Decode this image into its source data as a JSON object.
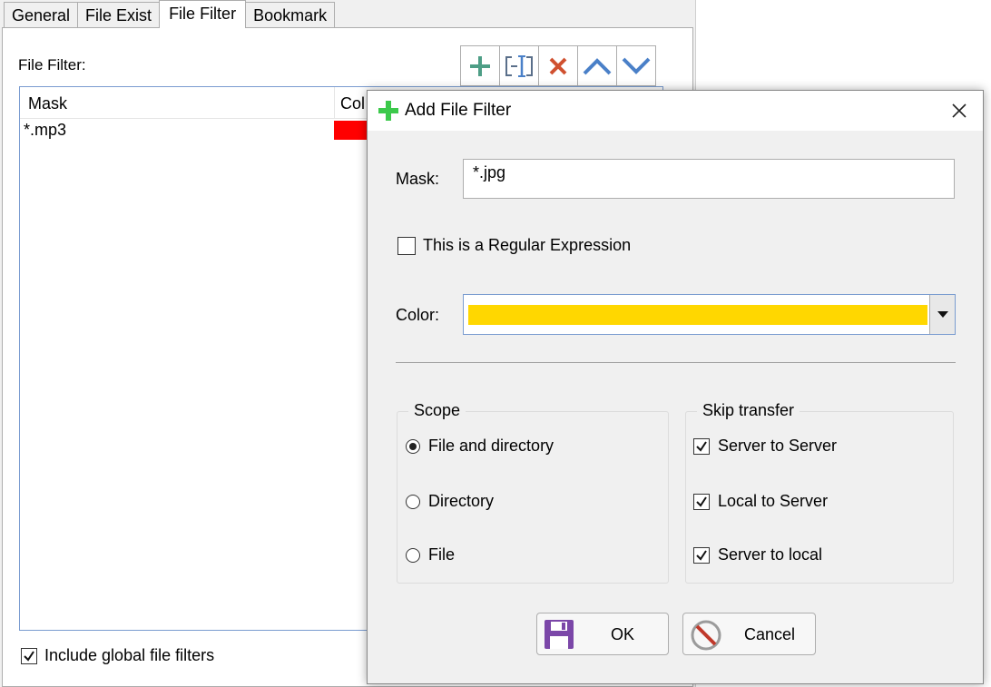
{
  "tabs": [
    {
      "label": "General",
      "active": false
    },
    {
      "label": "File Exist",
      "active": false
    },
    {
      "label": "File Filter",
      "active": true
    },
    {
      "label": "Bookmark",
      "active": false
    }
  ],
  "file_filter": {
    "label": "File Filter:",
    "toolbar": {
      "icons": [
        "add-icon",
        "rename-icon",
        "delete-icon",
        "move-up-icon",
        "move-down-icon"
      ],
      "colors": {
        "add": "#4e9e86",
        "delete": "#d0502f",
        "arrows": "#4a80c8",
        "rename": "#4a80c8"
      }
    },
    "columns": [
      "Mask",
      "Col"
    ],
    "rows": [
      {
        "mask": "*.mp3",
        "color": "#FF0000"
      }
    ],
    "include_global": {
      "label": "Include global file filters",
      "checked": true
    }
  },
  "dialog": {
    "title": "Add File Filter",
    "title_icon_color": "#3cc94b",
    "mask_label": "Mask:",
    "mask_value": "*.jpg",
    "regex_label": "This is a Regular Expression",
    "regex_checked": false,
    "color_label": "Color:",
    "color_value": "#FFD700",
    "scope": {
      "title": "Scope",
      "options": [
        {
          "label": "File and directory",
          "selected": true
        },
        {
          "label": "Directory",
          "selected": false
        },
        {
          "label": "File",
          "selected": false
        }
      ]
    },
    "skip_transfer": {
      "title": "Skip transfer",
      "options": [
        {
          "label": "Server to Server",
          "checked": true
        },
        {
          "label": "Local to Server",
          "checked": true
        },
        {
          "label": "Server to local",
          "checked": true
        }
      ]
    },
    "ok_label": "OK",
    "cancel_label": "Cancel"
  }
}
